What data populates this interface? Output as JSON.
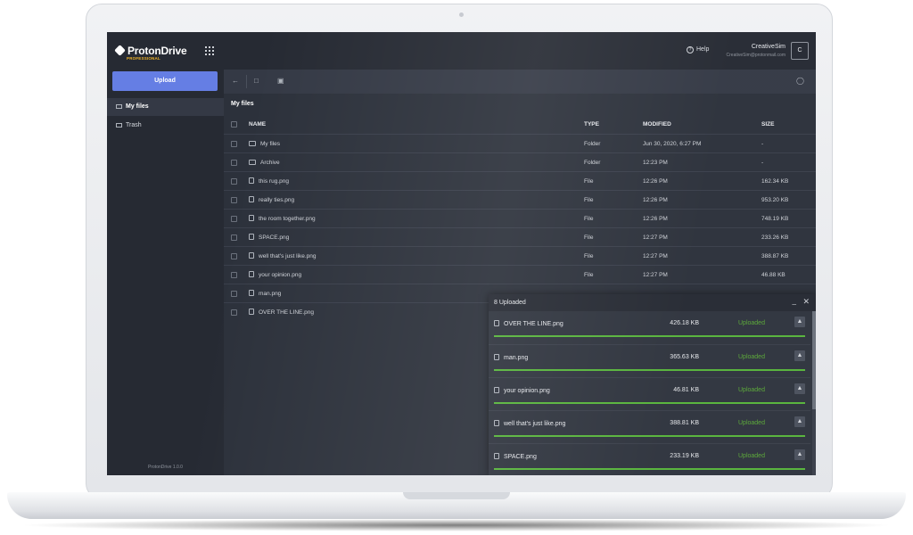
{
  "app": {
    "logo": "ProtonDrive",
    "logo_sub": "PROFESSIONAL",
    "version": "ProtonDrive 1.0.0"
  },
  "header": {
    "help_label": "Help",
    "user_name": "CreativeSim",
    "user_email": "CreativeSim@protonmail.com",
    "avatar_initial": "C"
  },
  "sidebar": {
    "upload_label": "Upload",
    "items": [
      {
        "label": "My files",
        "icon": "inbox-icon",
        "active": true
      },
      {
        "label": "Trash",
        "icon": "trash-icon",
        "active": false
      }
    ]
  },
  "breadcrumb": "My files",
  "table": {
    "columns": {
      "name": "NAME",
      "type": "TYPE",
      "modified": "MODIFIED",
      "size": "SIZE"
    },
    "rows": [
      {
        "name": "My files",
        "type": "Folder",
        "modified": "Jun 30, 2020, 6:27 PM",
        "size": "-",
        "icon": "folder-icon"
      },
      {
        "name": "Archive",
        "type": "Folder",
        "modified": "12:23 PM",
        "size": "-",
        "icon": "folder-icon"
      },
      {
        "name": "this rug.png",
        "type": "File",
        "modified": "12:26 PM",
        "size": "162.34 KB",
        "icon": "file-icon"
      },
      {
        "name": "really ties.png",
        "type": "File",
        "modified": "12:26 PM",
        "size": "953.20 KB",
        "icon": "file-icon"
      },
      {
        "name": "the room together.png",
        "type": "File",
        "modified": "12:26 PM",
        "size": "748.19 KB",
        "icon": "file-icon"
      },
      {
        "name": "SPACE.png",
        "type": "File",
        "modified": "12:27 PM",
        "size": "233.26 KB",
        "icon": "file-icon"
      },
      {
        "name": "well that's just like.png",
        "type": "File",
        "modified": "12:27 PM",
        "size": "388.87 KB",
        "icon": "file-icon"
      },
      {
        "name": "your opinion.png",
        "type": "File",
        "modified": "12:27 PM",
        "size": "46.88 KB",
        "icon": "file-icon"
      },
      {
        "name": "man.png",
        "type": "",
        "modified": "",
        "size": "",
        "icon": "file-icon"
      },
      {
        "name": "OVER THE LINE.png",
        "type": "",
        "modified": "",
        "size": "",
        "icon": "file-icon"
      }
    ]
  },
  "uploads": {
    "title": "8 Uploaded",
    "items": [
      {
        "name": "OVER THE LINE.png",
        "size": "426.18 KB",
        "status": "Uploaded",
        "progress": 1.0
      },
      {
        "name": "man.png",
        "size": "365.63 KB",
        "status": "Uploaded",
        "progress": 1.0
      },
      {
        "name": "your opinion.png",
        "size": "46.81 KB",
        "status": "Uploaded",
        "progress": 1.0
      },
      {
        "name": "well that's just like.png",
        "size": "388.81 KB",
        "status": "Uploaded",
        "progress": 1.0
      },
      {
        "name": "SPACE.png",
        "size": "233.19 KB",
        "status": "Uploaded",
        "progress": 1.0
      }
    ]
  },
  "colors": {
    "accent": "#657ee4",
    "success": "#57b43b",
    "logo_sub": "#f0b429"
  }
}
